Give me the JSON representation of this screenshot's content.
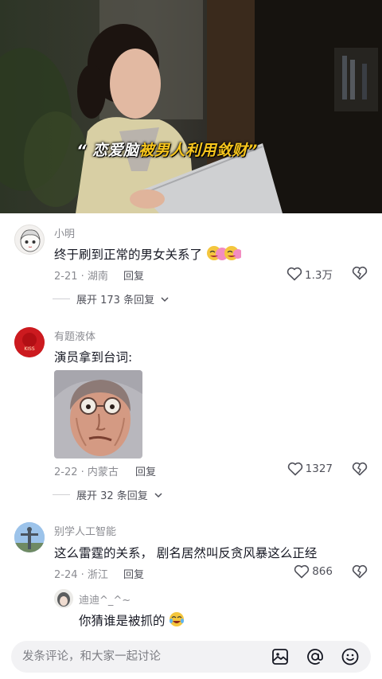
{
  "video": {
    "caption_white": "“ 恋爱脑",
    "caption_yellow": "被男人利用敛财”"
  },
  "comments": [
    {
      "username": "小明",
      "text": "终于刷到正常的男女关系了",
      "date_location": "2-21 · 湖南",
      "reply_label": "回复",
      "likes": "1.3万",
      "expand_label": "展开 173 条回复"
    },
    {
      "username": "有题液体",
      "avatar_text": "KISS",
      "text": "演员拿到台词:",
      "date_location": "2-22 · 内蒙古",
      "reply_label": "回复",
      "likes": "1327",
      "expand_label": "展开 32 条回复"
    },
    {
      "username": "别学人工智能",
      "text": "这么雷霆的关系， 剧名居然叫反贪风暴这么正经",
      "date_location": "2-24 · 浙江",
      "reply_label": "回复",
      "likes": "866"
    }
  ],
  "sub_reply": {
    "username": "迪迪^_^~",
    "text": "你猜谁是被抓的"
  },
  "input": {
    "placeholder": "发条评论，和大家一起讨论"
  },
  "icons": [
    "heart-icon",
    "broken-heart-icon",
    "chevron-down-icon",
    "image-icon",
    "at-icon",
    "emoji-icon"
  ],
  "colors": {
    "caption_highlight": "#f7c51c",
    "muted_text": "#8a8b91"
  }
}
